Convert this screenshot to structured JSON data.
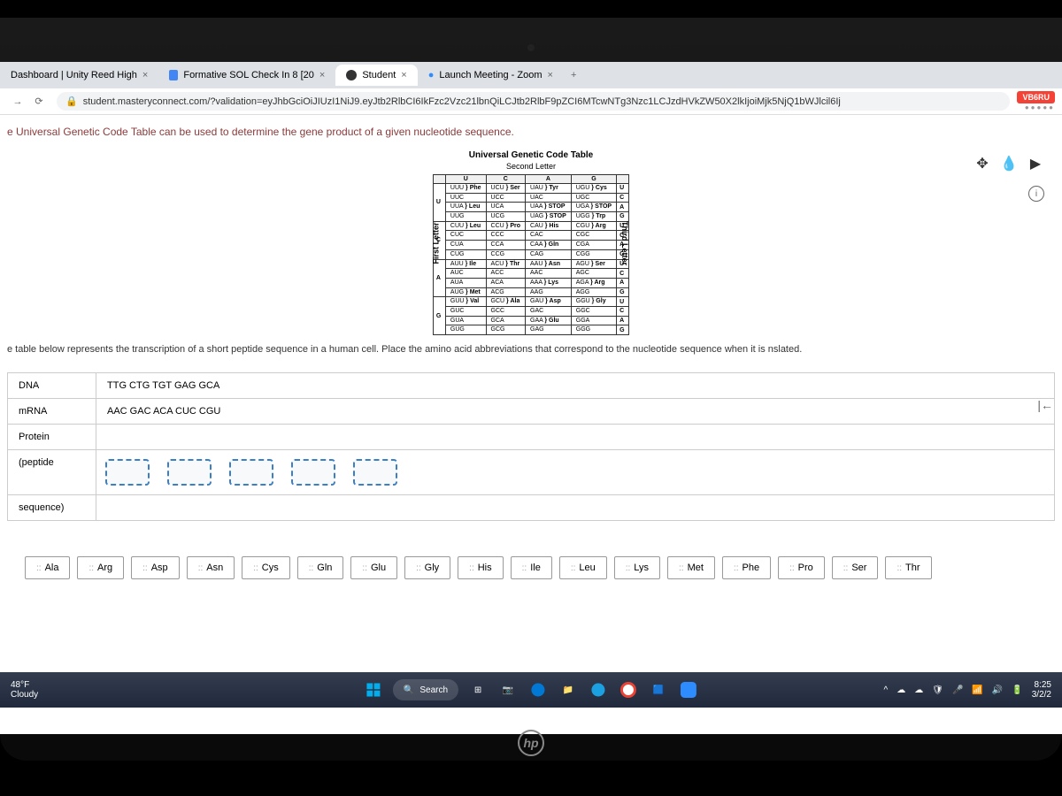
{
  "tabs": [
    {
      "label": "Dashboard | Unity Reed High"
    },
    {
      "label": "Formative SOL Check In 8 [20"
    },
    {
      "label": "Student"
    },
    {
      "label": "Launch Meeting - Zoom"
    }
  ],
  "url": "student.masteryconnect.com/?validation=eyJhbGciOiJIUzI1NiJ9.eyJtb2RlbCI6IkFzc2Vzc21lbnQiLCJtb2RlbF9pZCI6MTcwNTg3Nzc1LCJzdHVkZW50X2lkIjoiMjk5NjQ1bWJlcil6Ij",
  "badge_text": "VB6RU",
  "rating_dots": "●●●●●",
  "instruction": "e Universal Genetic Code Table can be used to determine the gene product of a given nucleotide sequence.",
  "codon_title": "Universal Genetic Code Table",
  "codon_subtitle": "Second Letter",
  "side_labels": {
    "first": "First Letter",
    "third": "Third Letter"
  },
  "codon_headers": [
    "",
    "U",
    "C",
    "A",
    "G",
    ""
  ],
  "codon_rows": [
    {
      "first": "U",
      "cells": [
        [
          [
            "UUU",
            "Phe"
          ],
          [
            "UUC",
            ""
          ],
          [
            "UUA",
            "Leu"
          ],
          [
            "UUG",
            ""
          ]
        ],
        [
          [
            "UCU",
            "Ser"
          ],
          [
            "UCC",
            ""
          ],
          [
            "UCA",
            ""
          ],
          [
            "UCG",
            ""
          ]
        ],
        [
          [
            "UAU",
            "Tyr"
          ],
          [
            "UAC",
            ""
          ],
          [
            "UAA",
            "STOP"
          ],
          [
            "UAG",
            "STOP"
          ]
        ],
        [
          [
            "UGU",
            "Cys"
          ],
          [
            "UGC",
            ""
          ],
          [
            "UGA",
            "STOP"
          ],
          [
            "UGG",
            "Trp"
          ]
        ]
      ],
      "third": [
        "U",
        "C",
        "A",
        "G"
      ]
    },
    {
      "first": "C",
      "cells": [
        [
          [
            "CUU",
            "Leu"
          ],
          [
            "CUC",
            ""
          ],
          [
            "CUA",
            ""
          ],
          [
            "CUG",
            ""
          ]
        ],
        [
          [
            "CCU",
            "Pro"
          ],
          [
            "CCC",
            ""
          ],
          [
            "CCA",
            ""
          ],
          [
            "CCG",
            ""
          ]
        ],
        [
          [
            "CAU",
            "His"
          ],
          [
            "CAC",
            ""
          ],
          [
            "CAA",
            "Gln"
          ],
          [
            "CAG",
            ""
          ]
        ],
        [
          [
            "CGU",
            "Arg"
          ],
          [
            "CGC",
            ""
          ],
          [
            "CGA",
            ""
          ],
          [
            "CGG",
            ""
          ]
        ]
      ],
      "third": [
        "U",
        "C",
        "A",
        "G"
      ]
    },
    {
      "first": "A",
      "cells": [
        [
          [
            "AUU",
            "Ile"
          ],
          [
            "AUC",
            ""
          ],
          [
            "AUA",
            ""
          ],
          [
            "AUG",
            "Met"
          ]
        ],
        [
          [
            "ACU",
            "Thr"
          ],
          [
            "ACC",
            ""
          ],
          [
            "ACA",
            ""
          ],
          [
            "ACG",
            ""
          ]
        ],
        [
          [
            "AAU",
            "Asn"
          ],
          [
            "AAC",
            ""
          ],
          [
            "AAA",
            "Lys"
          ],
          [
            "AAG",
            ""
          ]
        ],
        [
          [
            "AGU",
            "Ser"
          ],
          [
            "AGC",
            ""
          ],
          [
            "AGA",
            "Arg"
          ],
          [
            "AGG",
            ""
          ]
        ]
      ],
      "third": [
        "U",
        "C",
        "A",
        "G"
      ]
    },
    {
      "first": "G",
      "cells": [
        [
          [
            "GUU",
            "Val"
          ],
          [
            "GUC",
            ""
          ],
          [
            "GUA",
            ""
          ],
          [
            "GUG",
            ""
          ]
        ],
        [
          [
            "GCU",
            "Ala"
          ],
          [
            "GCC",
            ""
          ],
          [
            "GCA",
            ""
          ],
          [
            "GCG",
            ""
          ]
        ],
        [
          [
            "GAU",
            "Asp"
          ],
          [
            "GAC",
            ""
          ],
          [
            "GAA",
            "Glu"
          ],
          [
            "GAG",
            ""
          ]
        ],
        [
          [
            "GGU",
            "Gly"
          ],
          [
            "GGC",
            ""
          ],
          [
            "GGA",
            ""
          ],
          [
            "GGG",
            ""
          ]
        ]
      ],
      "third": [
        "U",
        "C",
        "A",
        "G"
      ]
    }
  ],
  "question": "e table below represents the transcription of a short peptide sequence in a human cell. Place the amino acid abbreviations that correspond to the nucleotide sequence when it is nslated.",
  "answer_rows": [
    {
      "label": "DNA",
      "value": "TTG CTG TGT GAG GCA"
    },
    {
      "label": "mRNA",
      "value": "AAC GAC ACA CUC CGU"
    },
    {
      "label": "Protein",
      "value": ""
    },
    {
      "label": "(peptide",
      "value": ""
    },
    {
      "label": "sequence)",
      "value": ""
    }
  ],
  "amino_acids": [
    "Ala",
    "Arg",
    "Asp",
    "Asn",
    "Cys",
    "Gln",
    "Glu",
    "Gly",
    "His",
    "Ile",
    "Leu",
    "Lys",
    "Met",
    "Phe",
    "Pro",
    "Ser",
    "Thr"
  ],
  "grip_symbol": "::",
  "weather": {
    "temp": "48°F",
    "cond": "Cloudy"
  },
  "search_label": "Search",
  "clock": {
    "time": "8:25",
    "date": "3/2/2"
  },
  "info_symbol": "i"
}
